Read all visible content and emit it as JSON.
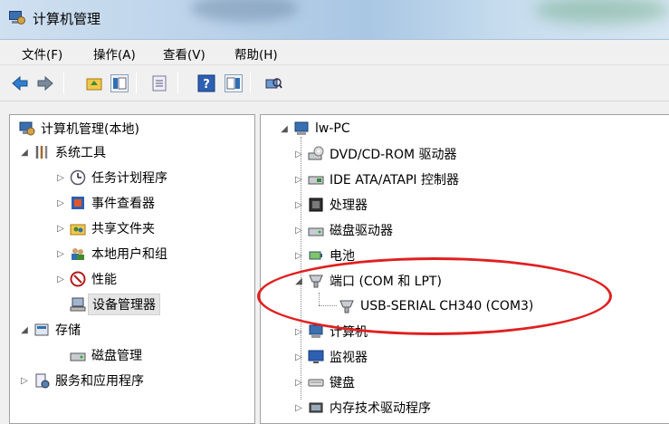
{
  "window": {
    "title": "计算机管理"
  },
  "menu": {
    "items": [
      "文件(F)",
      "操作(A)",
      "查看(V)",
      "帮助(H)"
    ]
  },
  "left_tree": {
    "root": "计算机管理(本地)",
    "items": [
      {
        "label": "系统工具",
        "expander": "◢"
      },
      {
        "label": "任务计划程序",
        "expander": "▷"
      },
      {
        "label": "事件查看器",
        "expander": "▷"
      },
      {
        "label": "共享文件夹",
        "expander": "▷"
      },
      {
        "label": "本地用户和组",
        "expander": "▷"
      },
      {
        "label": "性能",
        "expander": "▷"
      },
      {
        "label": "设备管理器",
        "expander": ""
      },
      {
        "label": "存储",
        "expander": "◢"
      },
      {
        "label": "磁盘管理",
        "expander": ""
      },
      {
        "label": "服务和应用程序",
        "expander": "▷"
      }
    ]
  },
  "right_tree": {
    "root": "lw-PC",
    "items": [
      {
        "label": "DVD/CD-ROM 驱动器",
        "expander": "▷"
      },
      {
        "label": "IDE ATA/ATAPI 控制器",
        "expander": "▷"
      },
      {
        "label": "处理器",
        "expander": "▷"
      },
      {
        "label": "磁盘驱动器",
        "expander": "▷"
      },
      {
        "label": "电池",
        "expander": "▷"
      },
      {
        "label": "端口 (COM 和 LPT)",
        "expander": "◢"
      },
      {
        "label": "USB-SERIAL CH340 (COM3)",
        "expander": ""
      },
      {
        "label": "计算机",
        "expander": "▷"
      },
      {
        "label": "监视器",
        "expander": "▷"
      },
      {
        "label": "键盘",
        "expander": "▷"
      },
      {
        "label": "内存技术驱动程序",
        "expander": "▷"
      }
    ]
  },
  "colors": {
    "annotation": "#e02020",
    "selection": "#e5e5e5"
  }
}
